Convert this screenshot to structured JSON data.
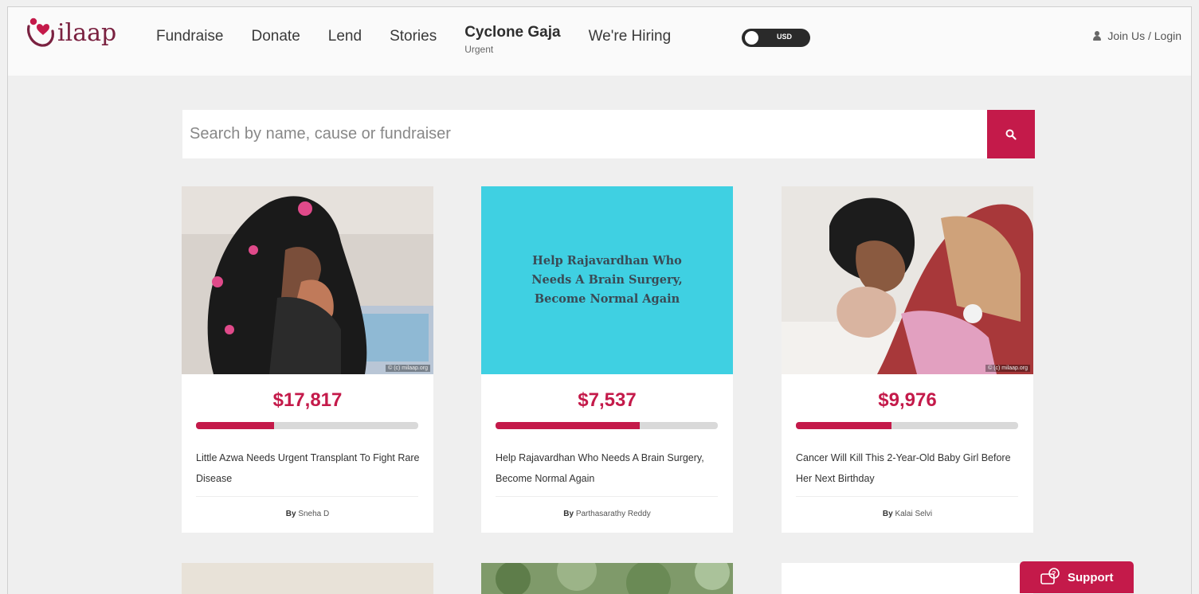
{
  "brand": {
    "logo_text": "ilaap",
    "accent": "#c41a4a",
    "logo_color": "#7a2140"
  },
  "nav": {
    "items": [
      "Fundraise",
      "Donate",
      "Lend",
      "Stories"
    ],
    "urgent_title": "Cyclone Gaja",
    "urgent_sub": "Urgent",
    "hiring": "We're Hiring"
  },
  "currency_toggle": {
    "label": "USD"
  },
  "login": {
    "label": "Join Us / Login",
    "icon": "user-icon"
  },
  "search": {
    "placeholder": "Search by name, cause or fundraiser",
    "icon": "search-icon"
  },
  "cards": [
    {
      "amount": "$17,817",
      "progress": 0.35,
      "title": "Little Azwa Needs Urgent Transplant To Fight Rare Disease",
      "by_label": "By",
      "by_name": "Sneha D",
      "watermark": "© (c) milaap.org"
    },
    {
      "amount": "$7,537",
      "progress": 0.65,
      "title": "Help Rajavardhan Who Needs A Brain Surgery, Become Normal Again",
      "by_label": "By",
      "by_name": "Parthasarathy Reddy",
      "image_text": "Help Rajavardhan Who Needs A Brain Surgery, Become Normal Again"
    },
    {
      "amount": "$9,976",
      "progress": 0.43,
      "title": "Cancer Will Kill This 2-Year-Old Baby Girl Before Her Next Birthday",
      "by_label": "By",
      "by_name": "Kalai Selvi",
      "watermark": "© (c) milaap.org"
    }
  ],
  "support": {
    "label": "Support",
    "icon": "support-chat-icon"
  }
}
